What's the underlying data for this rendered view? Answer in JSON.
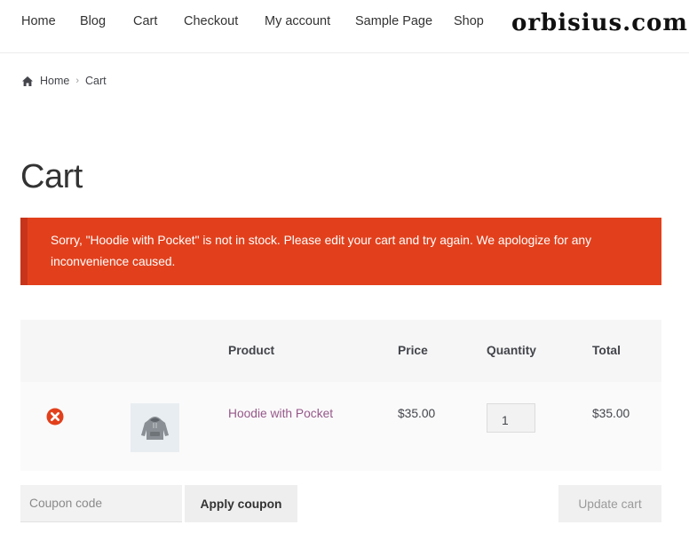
{
  "nav": {
    "items": [
      {
        "label": "Home"
      },
      {
        "label": "Blog"
      },
      {
        "label": "Cart"
      },
      {
        "label": "Checkout"
      },
      {
        "label": "My account"
      },
      {
        "label": "Sample Page"
      },
      {
        "label": "Shop"
      }
    ],
    "brand": "orbisius.com"
  },
  "breadcrumb": {
    "icon": "home-icon",
    "home": "Home",
    "separator": "›",
    "current": "Cart"
  },
  "page": {
    "title": "Cart"
  },
  "notice": {
    "text": "Sorry, \"Hoodie with Pocket\" is not in stock. Please edit your cart and try again. We apologize for any inconvenience caused.",
    "color": "#e2401c"
  },
  "cart": {
    "headers": {
      "product": "Product",
      "price": "Price",
      "quantity": "Quantity",
      "total": "Total"
    },
    "items": [
      {
        "remove_icon": "remove-icon",
        "thumbnail_icon": "hoodie-thumbnail",
        "product": "Hoodie with Pocket",
        "price": "$35.00",
        "quantity": "1",
        "total": "$35.00"
      }
    ]
  },
  "actions": {
    "coupon_placeholder": "Coupon code",
    "apply_label": "Apply coupon",
    "update_label": "Update cart"
  },
  "colors": {
    "link": "#96588a",
    "remove": "#e2401c"
  }
}
